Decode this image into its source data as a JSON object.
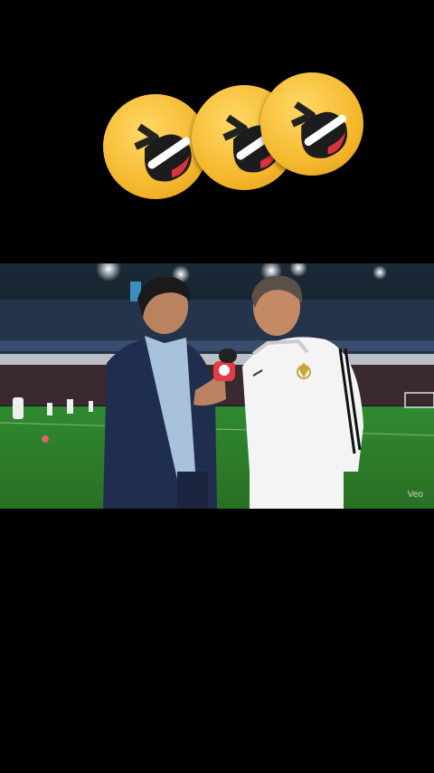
{
  "overlay": {
    "emojis": [
      "laughing-face-emoji",
      "laughing-face-emoji",
      "laughing-face-emoji"
    ]
  },
  "video": {
    "watermark": "Veo",
    "colors": {
      "pitch": "#2f8a2f",
      "stands": "#1d2b3a",
      "presenter_jacket": "#1f2d4f",
      "coach_jacket": "#f4f4f4",
      "microphone_flag": "#e23b4a"
    }
  }
}
